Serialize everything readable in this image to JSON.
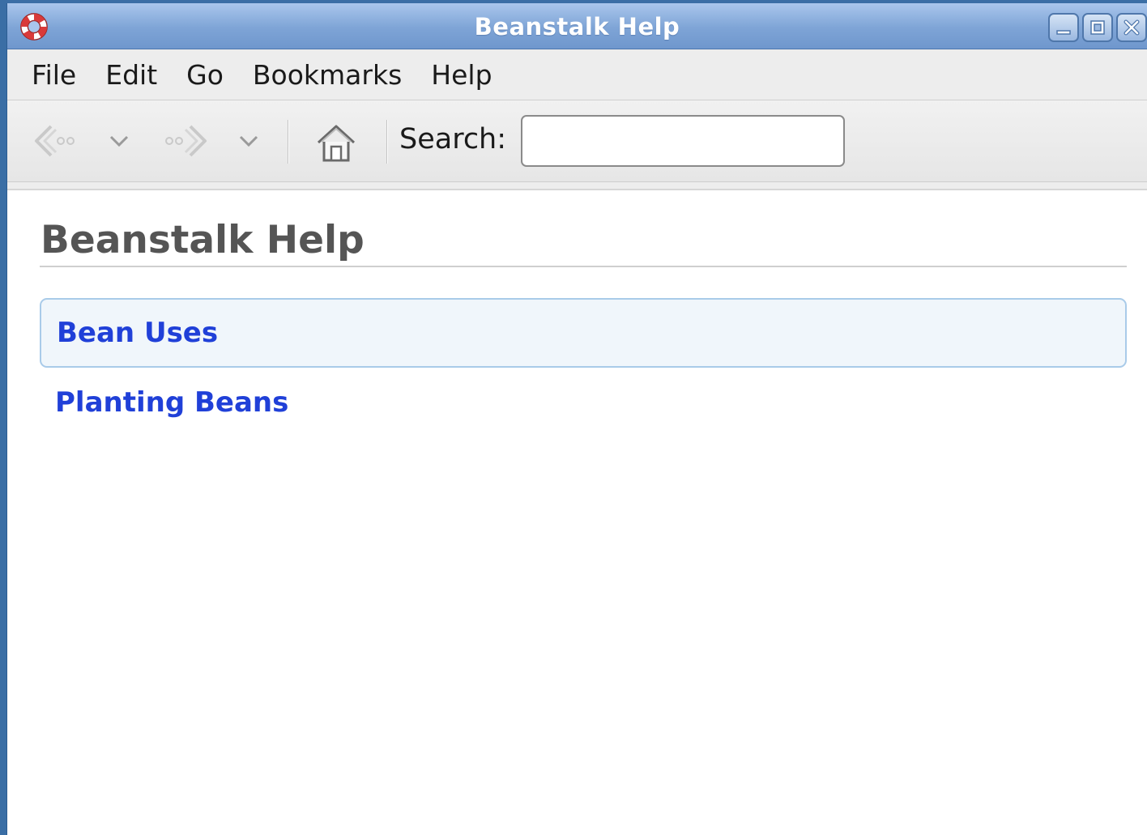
{
  "window": {
    "title": "Beanstalk Help",
    "app_icon": "lifebuoy-icon",
    "controls": [
      "minimize-icon",
      "maximize-icon",
      "close-icon"
    ]
  },
  "menubar": {
    "items": [
      "File",
      "Edit",
      "Go",
      "Bookmarks",
      "Help"
    ]
  },
  "toolbar": {
    "back_icon": "back-arrow-icon",
    "back_menu_icon": "chevron-down-icon",
    "forward_icon": "forward-arrow-icon",
    "forward_menu_icon": "chevron-down-icon",
    "home_icon": "home-icon",
    "search_label": "Search:",
    "search_value": ""
  },
  "content": {
    "page_title": "Beanstalk Help",
    "links": [
      "Bean Uses",
      "Planting Beans"
    ]
  },
  "colors": {
    "titlebar": "#7ea4d6",
    "link": "#2040d8",
    "heading": "#555555",
    "hover_background": "#f0f6fb",
    "hover_border": "#a9cbe9"
  }
}
